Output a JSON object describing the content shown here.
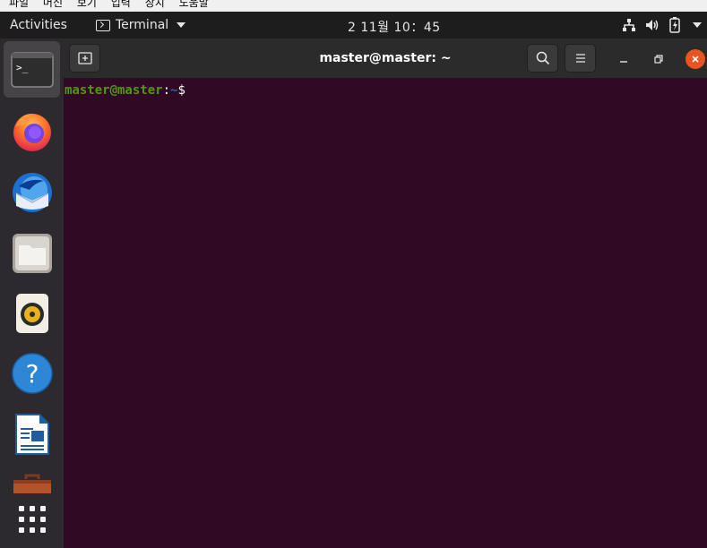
{
  "vm_menu": {
    "items": [
      "파일",
      "머신",
      "보기",
      "입력",
      "장치",
      "도움말"
    ]
  },
  "topbar": {
    "activities": "Activities",
    "app_name": "Terminal",
    "clock": "2 11월  10：45",
    "tray_icons": [
      "network-icon",
      "volume-icon",
      "battery-icon",
      "system-menu-icon"
    ]
  },
  "dock": {
    "items": [
      {
        "name": "terminal",
        "icon": "terminal-icon",
        "running": true
      },
      {
        "name": "firefox",
        "icon": "firefox-icon"
      },
      {
        "name": "thunderbird",
        "icon": "thunderbird-icon"
      },
      {
        "name": "files",
        "icon": "files-icon"
      },
      {
        "name": "rhythmbox",
        "icon": "rhythmbox-icon"
      },
      {
        "name": "help",
        "icon": "help-icon"
      },
      {
        "name": "libreoffice-writer",
        "icon": "writer-icon"
      },
      {
        "name": "ubuntu-software",
        "icon": "software-icon"
      },
      {
        "name": "show-applications",
        "icon": "app-grid-icon"
      }
    ]
  },
  "terminal": {
    "title": "master@master: ~",
    "prompt": {
      "user_host": "master@master",
      "colon": ":",
      "path": "~",
      "sign": "$"
    }
  },
  "colors": {
    "terminal_bg": "#300a24",
    "prompt_user": "#4e9a06",
    "prompt_path": "#3465a4",
    "close_button": "#e95420",
    "topbar_bg": "#1d1d1d",
    "dock_bg": "#2c2a2e"
  }
}
